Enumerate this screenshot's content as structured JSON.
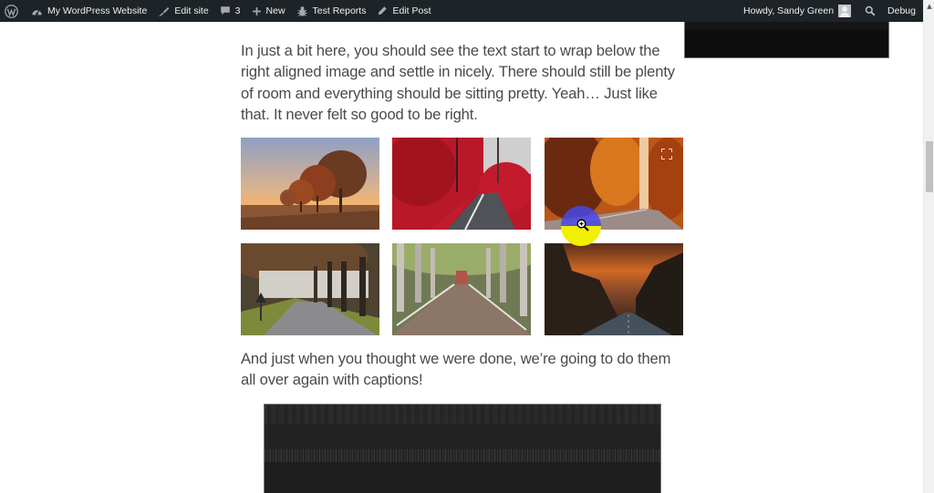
{
  "admin_bar": {
    "left_items": [
      {
        "name": "wordpress-logo",
        "icon": "wordpress-icon",
        "label": ""
      },
      {
        "name": "site-name",
        "icon": "dashboard-icon",
        "label": "My WordPress Website"
      },
      {
        "name": "edit-site",
        "icon": "brush-icon",
        "label": "Edit site"
      },
      {
        "name": "comments",
        "icon": "comment-icon",
        "label": "3"
      },
      {
        "name": "new-content",
        "icon": "plus-icon",
        "label": "New"
      },
      {
        "name": "test-reports",
        "icon": "bug-icon",
        "label": "Test Reports"
      },
      {
        "name": "edit-post",
        "icon": "pencil-icon",
        "label": "Edit Post"
      }
    ],
    "right_items": {
      "greeting": "Howdy, Sandy Green",
      "search_icon": "search-icon",
      "debug": "Debug"
    },
    "colors": {
      "background": "#1d2327",
      "text": "#f0f0f1"
    }
  },
  "article": {
    "paragraph_wrap": "In just a bit here, you should see the text start to wrap below the right aligned image and settle in nicely. There should still be plenty of room and everything should be sitting pretty. Yeah… Just like that. It never felt so good to be right.",
    "paragraph_captions": "And just when you thought we were done, we’re going to do them all over again with captions!",
    "text_color": "#4a4a4a"
  },
  "gallery": {
    "images": [
      {
        "alt": "Autumn trees at misty sunrise"
      },
      {
        "alt": "Red forest road"
      },
      {
        "alt": "Orange autumn forest road",
        "hover_icon": "expand-icon"
      },
      {
        "alt": "Misty tree-lined path with sign"
      },
      {
        "alt": "Birch alley road with leaves"
      },
      {
        "alt": "Mountain road at sunset"
      }
    ]
  },
  "cursor": {
    "icon": "zoom-in-cursor-icon",
    "highlight_colors": [
      "#4848e6",
      "#f2f000"
    ]
  },
  "scrollbar": {
    "position_fraction": 0.3
  }
}
